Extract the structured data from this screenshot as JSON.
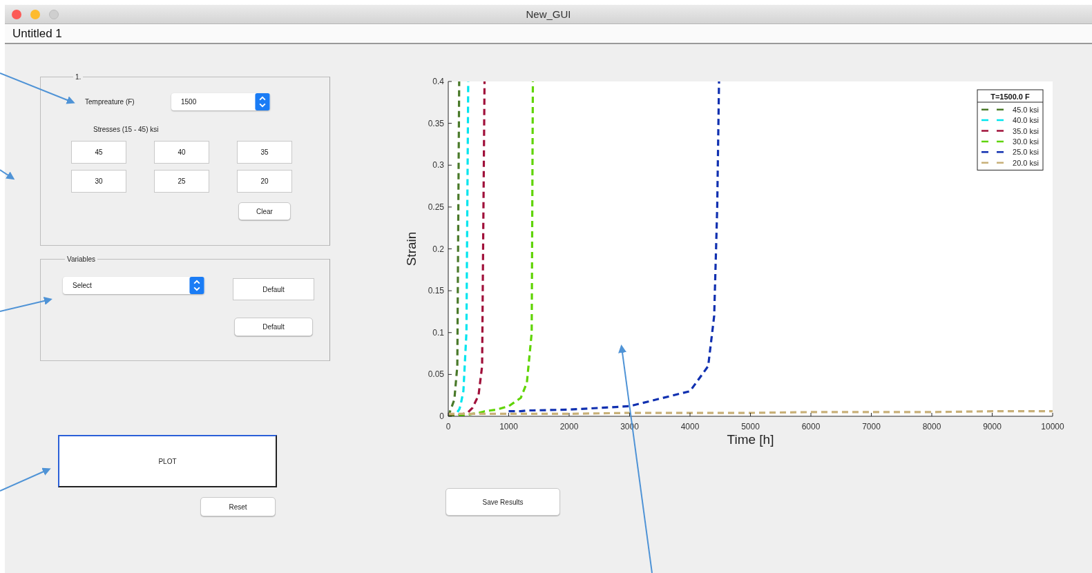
{
  "window": {
    "title": "New_GUI"
  },
  "document_tab": {
    "title": "Untitled 1"
  },
  "panel_1": {
    "title": "1.",
    "temperature_label": "Tempreature (F)",
    "temperature_popup": {
      "value": "1500"
    },
    "stresses_label": "Stresses (15 -  45) ksi",
    "stress_fields": [
      {
        "value": "45"
      },
      {
        "value": "40"
      },
      {
        "value": "35"
      },
      {
        "value": "30"
      },
      {
        "value": "25"
      },
      {
        "value": "20"
      }
    ],
    "clear_button": "Clear"
  },
  "variables_panel": {
    "title": "Variables",
    "variable_popup": {
      "value": "Select"
    },
    "default_field": {
      "value": "Default"
    },
    "default_button": "Default"
  },
  "plot_button": "PLOT",
  "reset_button": "Reset",
  "plot": {
    "chart_data": {
      "type": "line",
      "legend": {
        "title": "T=1500.0 F"
      },
      "xlabel": "Time [h]",
      "ylabel": "Strain",
      "xlim": [
        0,
        10000
      ],
      "ylim": [
        0,
        0.4
      ],
      "xticks": [
        0,
        1000,
        2000,
        3000,
        4000,
        5000,
        6000,
        7000,
        8000,
        9000,
        10000
      ],
      "yticks": [
        0,
        0.05,
        0.1,
        0.15,
        0.2,
        0.25,
        0.3,
        0.35,
        0.4
      ],
      "x": [
        0,
        100,
        150,
        180,
        200,
        250,
        300,
        330,
        400,
        500,
        560,
        600,
        700,
        800,
        1000,
        1200,
        1300,
        1380,
        1400,
        2000,
        3000,
        4000,
        4300,
        4400,
        4450,
        4480,
        5000,
        6000,
        7000,
        8000,
        9000,
        10000
      ],
      "series": [
        {
          "name": "45.0 ksi",
          "color": "#4a7a2a",
          "line_style": "dashed",
          "values": [
            0,
            0.02,
            0.06,
            0.4,
            null,
            null,
            null,
            null,
            null,
            null,
            null,
            null,
            null,
            null,
            null,
            null,
            null,
            null,
            null,
            null,
            null,
            null,
            null,
            null,
            null,
            null,
            null,
            null,
            null,
            null,
            null,
            null
          ]
        },
        {
          "name": "40.0 ksi",
          "color": "#00e5ee",
          "line_style": "dashed",
          "values": [
            0,
            0.002,
            0.005,
            0.008,
            0.012,
            0.03,
            0.1,
            0.4,
            null,
            null,
            null,
            null,
            null,
            null,
            null,
            null,
            null,
            null,
            null,
            null,
            null,
            null,
            null,
            null,
            null,
            null,
            null,
            null,
            null,
            null,
            null,
            null
          ]
        },
        {
          "name": "35.0 ksi",
          "color": "#a0103a",
          "line_style": "dashed",
          "values": [
            0,
            0.001,
            0.001,
            0.002,
            0.002,
            0.003,
            0.004,
            0.005,
            0.01,
            0.025,
            0.06,
            0.4,
            null,
            null,
            null,
            null,
            null,
            null,
            null,
            null,
            null,
            null,
            null,
            null,
            null,
            null,
            null,
            null,
            null,
            null,
            null,
            null
          ]
        },
        {
          "name": "30.0 ksi",
          "color": "#5fd400",
          "line_style": "dashed",
          "values": [
            0,
            0,
            0,
            0.001,
            0.001,
            0.001,
            0.002,
            0.002,
            0.003,
            0.004,
            0.005,
            0.006,
            0.007,
            0.008,
            0.012,
            0.022,
            0.04,
            0.1,
            0.4,
            null,
            null,
            null,
            null,
            null,
            null,
            null,
            null,
            null,
            null,
            null,
            null,
            null
          ]
        },
        {
          "name": "25.0 ksi",
          "color": "#1030b0",
          "line_style": "dashed",
          "values": [
            null,
            null,
            null,
            null,
            null,
            null,
            null,
            null,
            null,
            null,
            null,
            null,
            null,
            null,
            0.006,
            0.006,
            0.007,
            0.007,
            0.007,
            0.008,
            0.012,
            0.03,
            0.06,
            0.12,
            0.25,
            0.4,
            null,
            null,
            null,
            null,
            null,
            null
          ]
        },
        {
          "name": "20.0 ksi",
          "color": "#c8b078",
          "line_style": "dashed",
          "values": [
            0.003,
            0.003,
            0.003,
            0.003,
            0.003,
            0.003,
            0.003,
            0.003,
            0.003,
            0.003,
            0.003,
            0.003,
            0.003,
            0.003,
            0.003,
            0.003,
            0.003,
            0.003,
            0.003,
            0.003,
            0.004,
            0.004,
            0.004,
            0.004,
            0.004,
            0.004,
            0.004,
            0.005,
            0.005,
            0.005,
            0.006,
            0.006
          ]
        }
      ]
    }
  },
  "save_button": "Save Results"
}
